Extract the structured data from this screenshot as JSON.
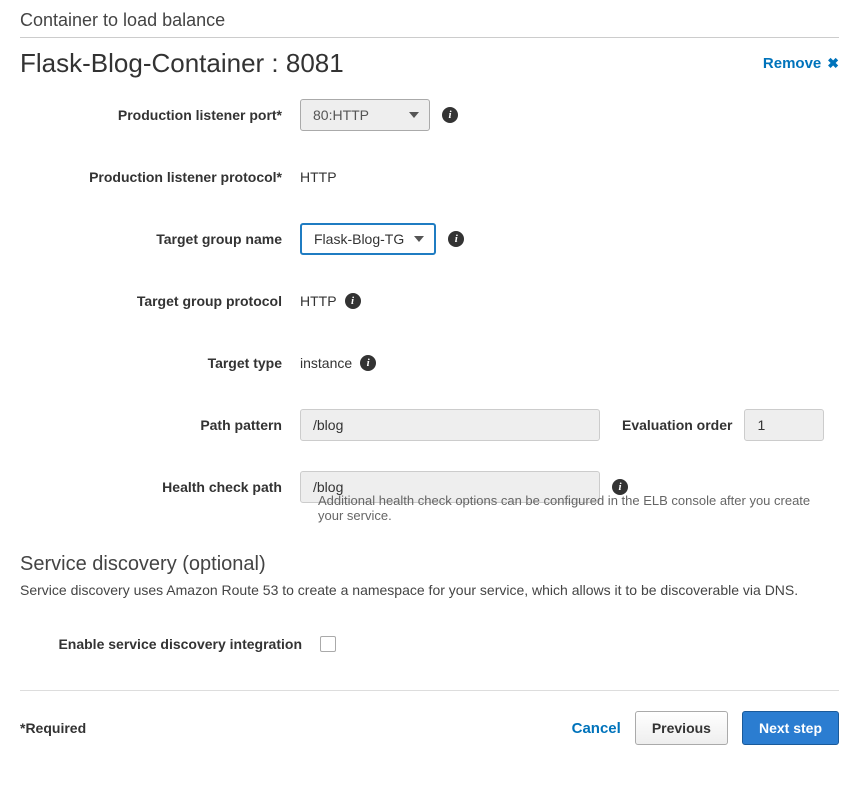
{
  "section": {
    "title": "Container to load balance"
  },
  "container": {
    "title": "Flask-Blog-Container : 8081",
    "remove_label": "Remove"
  },
  "form": {
    "prod_listener_port_label": "Production listener port*",
    "prod_listener_port_value": "80:HTTP",
    "prod_listener_protocol_label": "Production listener protocol*",
    "prod_listener_protocol_value": "HTTP",
    "target_group_name_label": "Target group name",
    "target_group_name_value": "Flask-Blog-TG",
    "target_group_protocol_label": "Target group protocol",
    "target_group_protocol_value": "HTTP",
    "target_type_label": "Target type",
    "target_type_value": "instance",
    "path_pattern_label": "Path pattern",
    "path_pattern_value": "/blog",
    "eval_order_label": "Evaluation order",
    "eval_order_value": "1",
    "health_check_label": "Health check path",
    "health_check_value": "/blog",
    "health_check_helper": "Additional health check options can be configured in the ELB console after you create your service."
  },
  "discovery": {
    "title": "Service discovery (optional)",
    "desc": "Service discovery uses Amazon Route 53 to create a namespace for your service, which allows it to be discoverable via DNS.",
    "enable_label": "Enable service discovery integration"
  },
  "footer": {
    "required": "*Required",
    "cancel": "Cancel",
    "previous": "Previous",
    "next": "Next step"
  }
}
